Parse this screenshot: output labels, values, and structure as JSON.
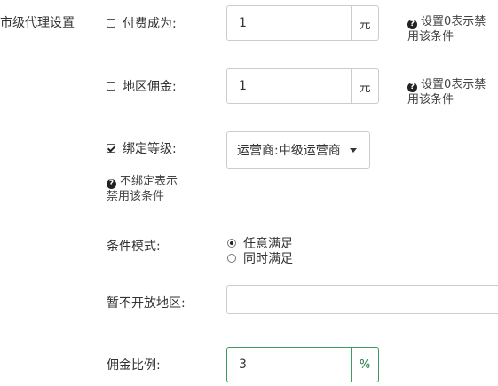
{
  "section": {
    "title": "市级代理设置"
  },
  "paid": {
    "checkbox_label": "付费成为:",
    "value": "1",
    "unit": "元",
    "help": [
      "设置0表示禁",
      "用该条件"
    ]
  },
  "region_commission": {
    "checkbox_label": "地区佣金:",
    "value": "1",
    "unit": "元",
    "help": [
      "设置0表示禁",
      "用该条件"
    ]
  },
  "bind_level": {
    "checkbox_label": "绑定等级:",
    "selected": "运营商:中级运营商",
    "help": [
      "不绑定表示",
      "禁用该条件"
    ]
  },
  "condition_mode": {
    "label": "条件模式:",
    "options": [
      "任意满足",
      "同时满足"
    ],
    "selected_index": 0
  },
  "closed_regions": {
    "label": "暂不开放地区:",
    "value": ""
  },
  "commission_ratio": {
    "label": "佣金比例:",
    "value": "3",
    "unit": "%"
  },
  "icons": {
    "checkbox": "checkbox-icon",
    "help": "question-circle-icon",
    "caret": "caret-down-icon",
    "radio": "radio-icon"
  }
}
